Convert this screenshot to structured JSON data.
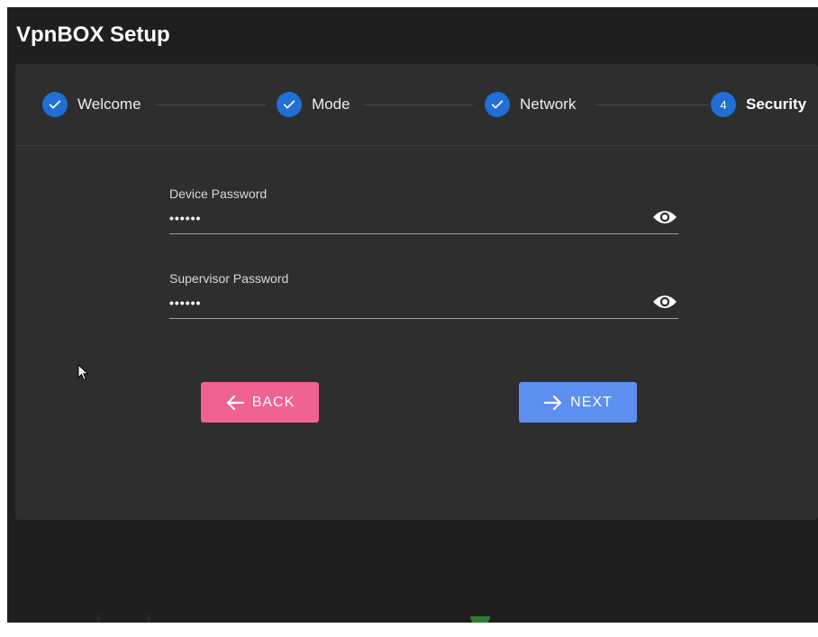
{
  "app": {
    "title": "VpnBOX Setup"
  },
  "stepper": {
    "steps": [
      {
        "label": "Welcome",
        "state": "completed",
        "icon": "check-icon"
      },
      {
        "label": "Mode",
        "state": "completed",
        "icon": "check-icon"
      },
      {
        "label": "Network",
        "state": "completed",
        "icon": "check-icon"
      },
      {
        "label": "Security",
        "state": "active",
        "number": "4"
      }
    ]
  },
  "form": {
    "device_password": {
      "label": "Device Password",
      "value": "••••••",
      "icon": "eye-icon"
    },
    "supervisor_password": {
      "label": "Supervisor Password",
      "value": "••••••",
      "icon": "eye-icon"
    }
  },
  "buttons": {
    "back": {
      "label": "BACK",
      "icon": "arrow-left-icon",
      "color": "#f06292"
    },
    "next": {
      "label": "NEXT",
      "icon": "arrow-right-icon",
      "color": "#5c8ff0"
    }
  },
  "colors": {
    "step_accent": "#1f6fd6",
    "background": "#1f1f1f",
    "card": "#2e2e2e"
  }
}
